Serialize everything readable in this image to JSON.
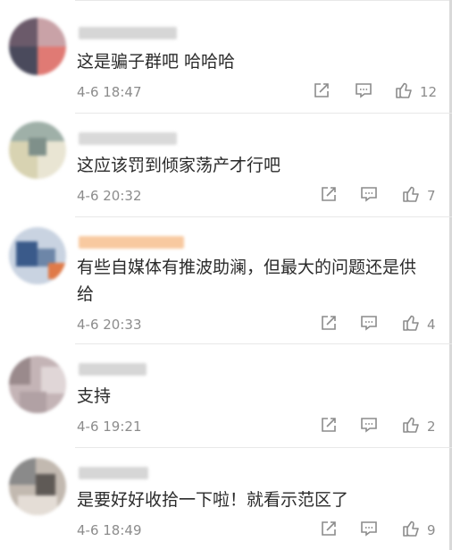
{
  "comments": [
    {
      "text": "这是骗子群吧 哈哈哈",
      "time": "4-6 18:47",
      "likes": "12",
      "avatar_colors": [
        "#6b5a6a",
        "#c9a2a7",
        "#4a4a5c",
        "#e1d7d9"
      ]
    },
    {
      "text": "这应该罚到倾家荡产才行吧",
      "time": "4-6 20:32",
      "likes": "7",
      "avatar_colors": [
        "#8fa29a",
        "#d8d3b2",
        "#b9c6bf",
        "#e9e5d3"
      ]
    },
    {
      "text": "有些自媒体有推波助澜，但最大的问题还是供给",
      "time": "4-6 20:33",
      "likes": "4",
      "avatar_colors": [
        "#3a5a8a",
        "#e07a48",
        "#6d86a8",
        "#c9d3e1"
      ]
    },
    {
      "text": "支持",
      "time": "4-6 19:21",
      "likes": "2",
      "avatar_colors": [
        "#9a8a8c",
        "#c4b4b6",
        "#e0d6d7",
        "#b1a1a4"
      ]
    },
    {
      "text": "是要好好收拾一下啦！就看示范区了",
      "time": "4-6 18:49",
      "likes": "9",
      "avatar_colors": [
        "#8a8a8a",
        "#c2b9b0",
        "#5f5a56",
        "#e4ddd6"
      ]
    }
  ],
  "icons": {
    "share": "share-icon",
    "comment": "comment-icon",
    "like": "thumbs-up-icon"
  },
  "colors": {
    "text": "#2b2b2b",
    "meta": "#8c8c8c",
    "divider": "#e8e8e8",
    "highlight_name": "#f8c9a0"
  }
}
